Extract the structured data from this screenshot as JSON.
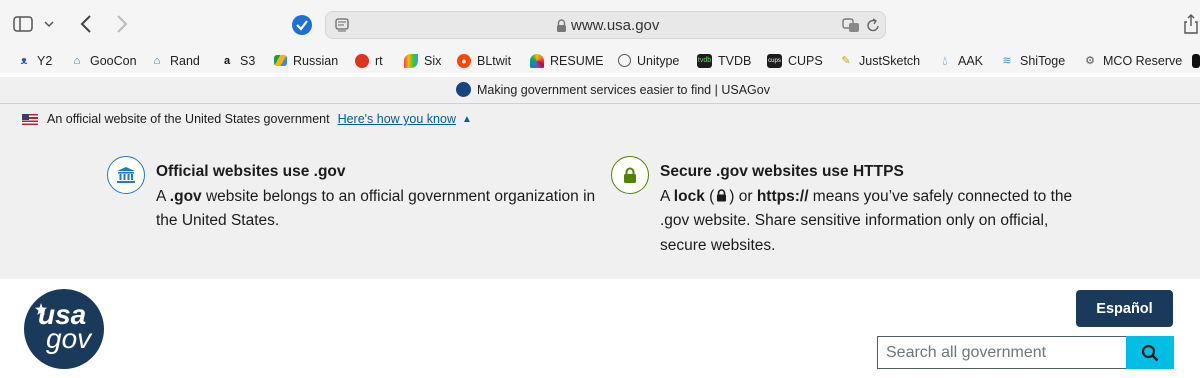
{
  "browser": {
    "url": "www.usa.gov",
    "tab_title": "Making government services easier to find | USAGov",
    "bookmarks": [
      {
        "label": "Y2",
        "icon": "bluebird-icon"
      },
      {
        "label": "GooCon",
        "icon": "ufo-icon"
      },
      {
        "label": "Rand",
        "icon": "ufo-icon"
      },
      {
        "label": "S3",
        "icon": "amazon-icon"
      },
      {
        "label": "Russian",
        "icon": "google-drive-icon"
      },
      {
        "label": "rt",
        "icon": "tomato-icon"
      },
      {
        "label": "Six",
        "icon": "color-leaf-icon"
      },
      {
        "label": "BLtwit",
        "icon": "reddit-icon"
      },
      {
        "label": "RESUME",
        "icon": "peacock-icon"
      },
      {
        "label": "Unitype",
        "icon": "globe-icon"
      },
      {
        "label": "TVDB",
        "icon": "tvdb-icon"
      },
      {
        "label": "CUPS",
        "icon": "cups-icon"
      },
      {
        "label": "JustSketch",
        "icon": "sketch-icon"
      },
      {
        "label": "AAK",
        "icon": "drop-icon"
      },
      {
        "label": "ShiToge",
        "icon": "tornado-icon"
      },
      {
        "label": "MCO Reserve",
        "icon": "gear-icon"
      }
    ]
  },
  "banner": {
    "official_text": "An official website of the United States government",
    "how_link": "Here's how you know",
    "left_title": "Official websites use .gov",
    "left_body_a": "A ",
    "left_body_bold": ".gov",
    "left_body_b": " website belongs to an official government organization in the United States.",
    "right_title": "Secure .gov websites use HTTPS",
    "right_a": "A ",
    "right_lock_word": "lock",
    "right_b": " (",
    "right_c": ") or ",
    "right_https": "https://",
    "right_d": " means you’ve safely connected to the .gov website. Share sensitive information only on official, secure websites."
  },
  "header": {
    "logo_top": "usa",
    "logo_bottom": "gov",
    "espanol": "Español",
    "search_placeholder": "Search all government"
  }
}
